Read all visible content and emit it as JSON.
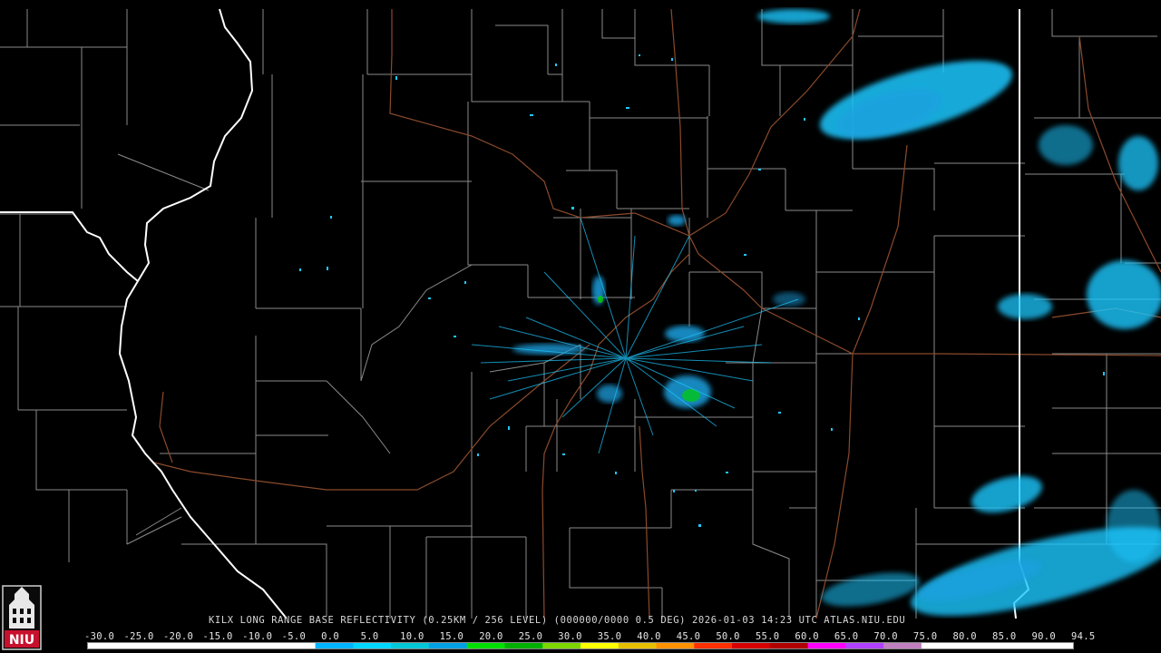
{
  "product": {
    "caption": "KILX LONG RANGE BASE REFLECTIVITY (0.25KM / 256 LEVEL) (000000/0000 0.5 DEG) 2026-01-03 14:23 UTC  ATLAS.NIU.EDU"
  },
  "legend": {
    "labels": [
      "-30.0",
      "-25.0",
      "-20.0",
      "-15.0",
      "-10.0",
      "-5.0",
      "0.0",
      "5.0",
      "10.0",
      "15.0",
      "20.0",
      "25.0",
      "30.0",
      "35.0",
      "40.0",
      "45.0",
      "50.0",
      "55.0",
      "60.0",
      "65.0",
      "70.0",
      "75.0",
      "80.0",
      "85.0",
      "90.0",
      "94.5"
    ],
    "colors": [
      "#ffffff",
      "#ffffff",
      "#ffffff",
      "#ffffff",
      "#ffffff",
      "#ffffff",
      "#00b4ff",
      "#00d6ff",
      "#00c6d6",
      "#00a0e6",
      "#00e000",
      "#00b000",
      "#7cd600",
      "#ffff00",
      "#e6c000",
      "#ff9000",
      "#ff3000",
      "#d60000",
      "#b00000",
      "#ff00ff",
      "#b040ff",
      "#c080c0",
      "#ffffff",
      "#ffffff",
      "#ffffff",
      "#ffffff"
    ]
  },
  "colors": {
    "background": "#000000",
    "county_lines": "#8a8a8a",
    "state_lines": "#ffffff",
    "highways": "#8b4a2b",
    "echo_light": "#1ec8ff",
    "echo_mid": "#1aa0e0",
    "echo_green": "#00d000"
  },
  "logo": {
    "text": "NIU",
    "color": "#c8102e"
  }
}
